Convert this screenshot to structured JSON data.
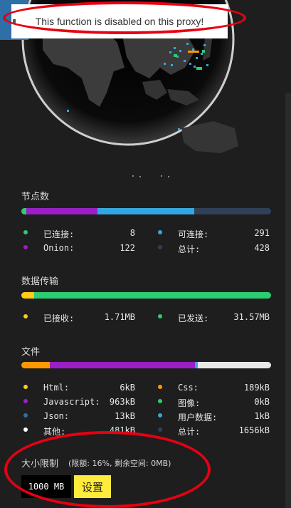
{
  "notice": {
    "text": "This function is disabled on this proxy!"
  },
  "nodes": {
    "title": "节点数",
    "bar": [
      {
        "color": "#2ecc71",
        "fraction": 0.019
      },
      {
        "color": "#9b1fc4",
        "fraction": 0.285
      },
      {
        "color": "#35a7e0",
        "fraction": 0.389
      },
      {
        "color": "#2f4057",
        "fraction": 0.307
      }
    ],
    "items": [
      {
        "label": "已连接:",
        "value": "8",
        "color": "#2ecc71"
      },
      {
        "label": "可连接:",
        "value": "291",
        "color": "#35a7e0"
      },
      {
        "label": "Onion:",
        "value": "122",
        "color": "#9b1fc4"
      },
      {
        "label": "总计:",
        "value": "428",
        "color": "#2f4057"
      }
    ]
  },
  "transfer": {
    "title": "数据传输",
    "bar": [
      {
        "color": "#ffcc1a",
        "fraction": 0.052
      },
      {
        "color": "#2ecc71",
        "fraction": 0.948
      }
    ],
    "items": [
      {
        "label": "已接收:",
        "value": "1.71MB",
        "color": "#ffcc1a"
      },
      {
        "label": "已发送:",
        "value": "31.57MB",
        "color": "#2ecc71"
      }
    ]
  },
  "files": {
    "title": "文件",
    "bar": [
      {
        "color": "#ff9800",
        "fraction": 0.114
      },
      {
        "color": "#9b1fc4",
        "fraction": 0.582
      },
      {
        "color": "#35a7e0",
        "fraction": 0.008
      },
      {
        "color": "#2ecc71",
        "fraction": 0.003
      },
      {
        "color": "#e8e8e8",
        "fraction": 0.293
      }
    ],
    "items": [
      {
        "label": "Html:",
        "value": "6kB",
        "color": "#ffcc1a"
      },
      {
        "label": "Css:",
        "value": "189kB",
        "color": "#ff9800"
      },
      {
        "label": "Javascript:",
        "value": "963kB",
        "color": "#9b1fc4"
      },
      {
        "label": "图像:",
        "value": "0kB",
        "color": "#2ecc71"
      },
      {
        "label": "Json:",
        "value": "13kB",
        "color": "#2f6fa7"
      },
      {
        "label": "用户数据:",
        "value": "1kB",
        "color": "#35a7e0"
      },
      {
        "label": "其他:",
        "value": "481kB",
        "color": "#ffffff"
      },
      {
        "label": "总计:",
        "value": "1656kB",
        "color": "#2f4057"
      }
    ]
  },
  "size_limit": {
    "label": "大小限制",
    "note": "(限额: 16%, 剩余空间: 0MB)",
    "input_value": "1000 MB",
    "button_label": "设置"
  }
}
